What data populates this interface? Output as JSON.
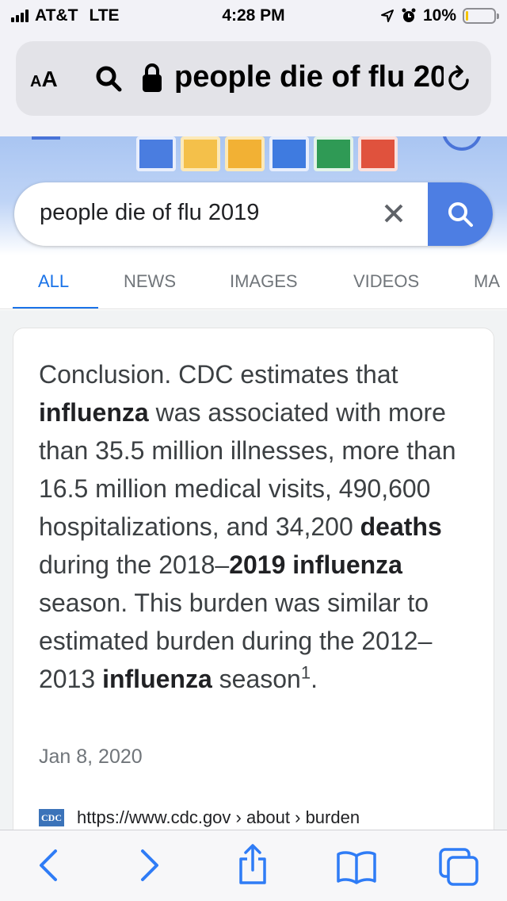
{
  "status_bar": {
    "carrier": "AT&T",
    "network": "LTE",
    "time": "4:28 PM",
    "battery": "10%",
    "battery_level": 0.1
  },
  "address_bar": {
    "text_size_small": "A",
    "text_size_large": "A",
    "url_text": "people die of flu 2019"
  },
  "search": {
    "query": "people die of flu 2019"
  },
  "tabs": [
    {
      "label": "ALL",
      "active": true
    },
    {
      "label": "NEWS",
      "active": false
    },
    {
      "label": "IMAGES",
      "active": false
    },
    {
      "label": "VIDEOS",
      "active": false
    },
    {
      "label": "MA",
      "active": false
    }
  ],
  "result": {
    "snippet_parts": [
      {
        "text": "Conclusion. CDC estimates that ",
        "bold": false
      },
      {
        "text": "influenza",
        "bold": true
      },
      {
        "text": " was associated with more than 35.5 million illnesses, more than 16.5 million medical visits, 490,600 hospitalizations, and 34,200 ",
        "bold": false
      },
      {
        "text": "deaths",
        "bold": true
      },
      {
        "text": " during the 2018–",
        "bold": false
      },
      {
        "text": "2019 influenza",
        "bold": true
      },
      {
        "text": " season. This burden was similar to estimated burden during the 2012–2013 ",
        "bold": false
      },
      {
        "text": "influenza",
        "bold": true
      },
      {
        "text": " season",
        "bold": false
      }
    ],
    "footnote": "1",
    "end_punct": ".",
    "date": "Jan 8, 2020",
    "source_logo": "CDC",
    "source_url": "https://www.cdc.gov › about › burden"
  },
  "colors": {
    "accent": "#1a73e8",
    "search_button": "#4d7ee3",
    "ios_blue": "#2f7cf6",
    "battery_fill": "#f5c400"
  },
  "toolbar": {
    "icons": [
      "back-icon",
      "forward-icon",
      "share-icon",
      "bookmarks-icon",
      "tabs-icon"
    ]
  }
}
